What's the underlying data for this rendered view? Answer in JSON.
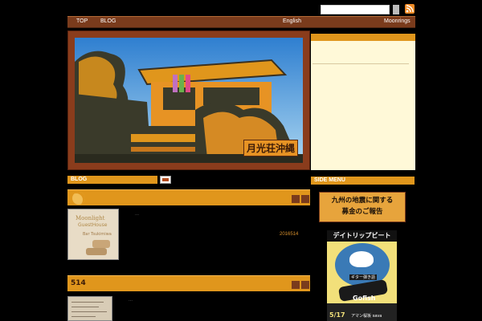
{
  "nav": {
    "top": "TOP",
    "blog": "BLOG",
    "english": "English",
    "moonrings": "Moonrings"
  },
  "header": {
    "title": "月光荘沖縄"
  },
  "sections": {
    "blog": "BLOG",
    "side_menu": "SIDE MENU"
  },
  "posts": [
    {
      "title": "",
      "date": "2016514",
      "thumb": {
        "line1": "Moonlight",
        "line2": "GuestHouse",
        "line3": "Bar Tsukimiwa"
      }
    },
    {
      "title": "514",
      "date": ""
    }
  ],
  "side": {
    "banner_line1": "九州の地震に関する",
    "banner_line2": "募金のご報告",
    "poster": {
      "title": "デイトリップビート",
      "tag": "ギター弾き語",
      "name": "Gofish",
      "date": "5/17",
      "info": "アマン桜坂 sava"
    }
  },
  "colors": {
    "accent": "#e0961c",
    "nav_bg": "#7a3b1c",
    "panel_bg": "#fff9d8",
    "frame": "#8a3c1c"
  },
  "icons": {
    "rss": "rss-icon"
  }
}
